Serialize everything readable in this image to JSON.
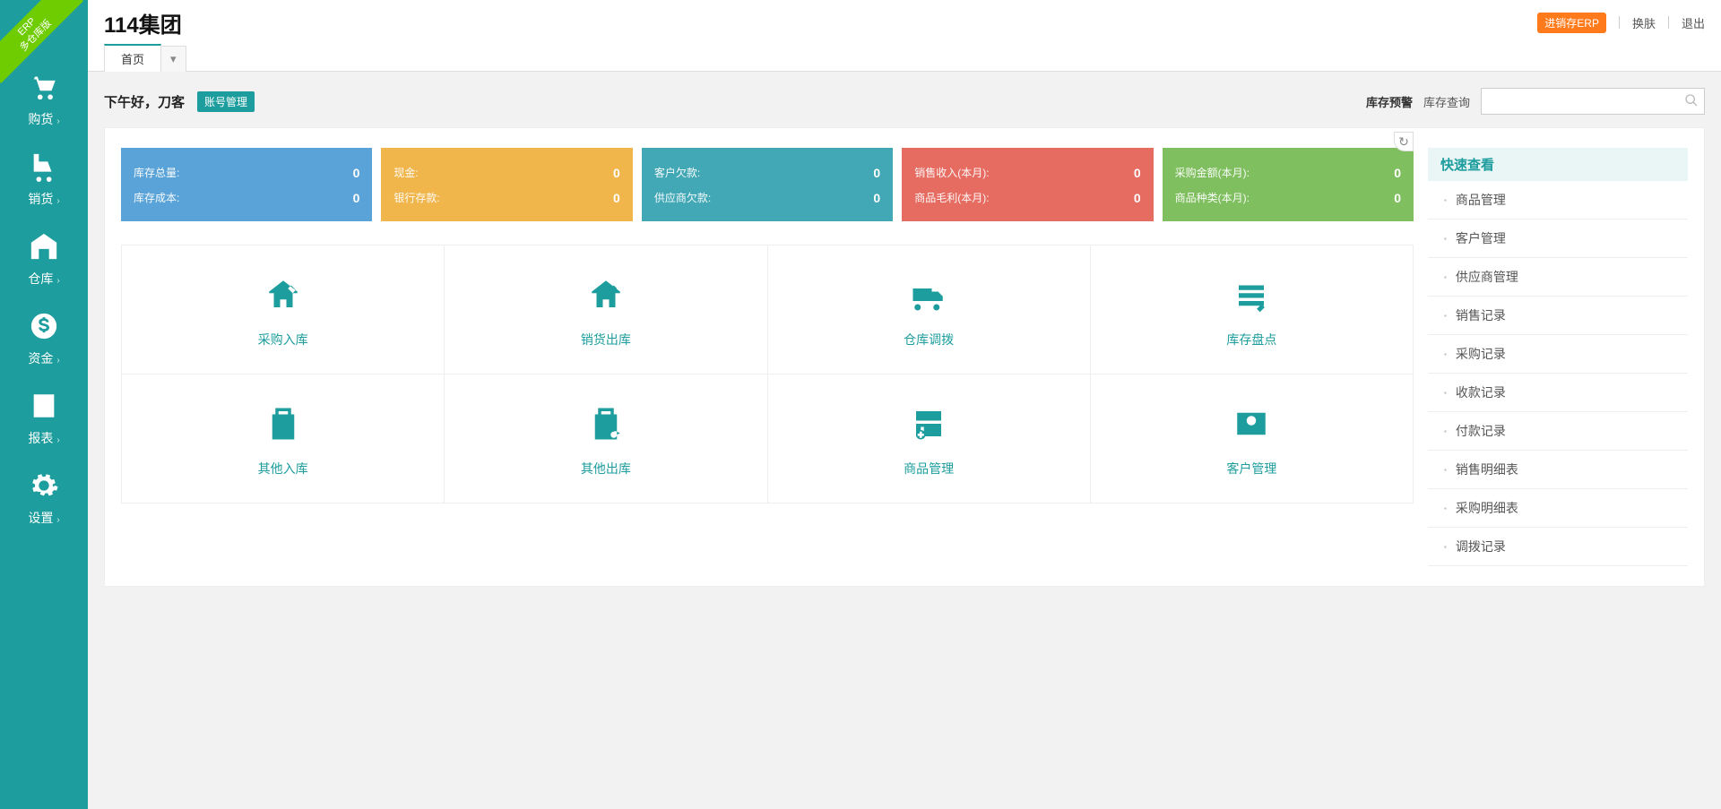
{
  "ribbon": {
    "line1": "ERP",
    "line2": "多仓库版"
  },
  "company_name": "114集团",
  "top_right": {
    "erp_badge": "进销存ERP",
    "skin": "换肤",
    "logout": "退出"
  },
  "sidebar": {
    "items": [
      {
        "label": "购货"
      },
      {
        "label": "销货"
      },
      {
        "label": "仓库"
      },
      {
        "label": "资金"
      },
      {
        "label": "报表"
      },
      {
        "label": "设置"
      }
    ]
  },
  "tabs": {
    "home": "首页"
  },
  "greeting": "下午好，刀客",
  "account_mgmt_btn": "账号管理",
  "alert_label": "库存预警",
  "search_label": "库存查询",
  "search_placeholder": "",
  "stats": [
    {
      "color": "c-blue",
      "rows": [
        [
          "库存总量:",
          "0"
        ],
        [
          "库存成本:",
          "0"
        ]
      ]
    },
    {
      "color": "c-orange",
      "rows": [
        [
          "现金:",
          "0"
        ],
        [
          "银行存款:",
          "0"
        ]
      ]
    },
    {
      "color": "c-teal",
      "rows": [
        [
          "客户欠款:",
          "0"
        ],
        [
          "供应商欠款:",
          "0"
        ]
      ]
    },
    {
      "color": "c-red",
      "rows": [
        [
          "销售收入(本月):",
          "0"
        ],
        [
          "商品毛利(本月):",
          "0"
        ]
      ]
    },
    {
      "color": "c-green",
      "rows": [
        [
          "采购金额(本月):",
          "0"
        ],
        [
          "商品种类(本月):",
          "0"
        ]
      ]
    }
  ],
  "grid": [
    [
      "采购入库",
      "销货出库",
      "仓库调拨",
      "库存盘点"
    ],
    [
      "其他入库",
      "其他出库",
      "商品管理",
      "客户管理"
    ]
  ],
  "quick": {
    "title": "快速查看",
    "items": [
      "商品管理",
      "客户管理",
      "供应商管理",
      "销售记录",
      "采购记录",
      "收款记录",
      "付款记录",
      "销售明细表",
      "采购明细表",
      "调拨记录"
    ]
  }
}
